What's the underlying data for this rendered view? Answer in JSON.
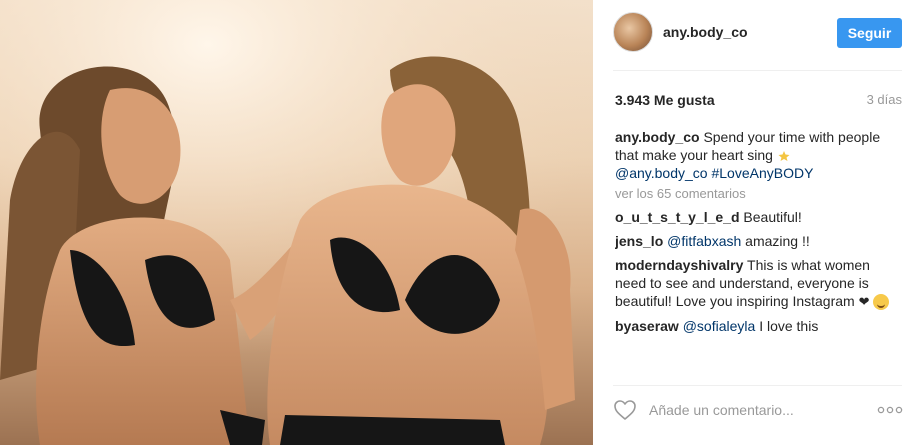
{
  "post": {
    "username": "any.body_co",
    "follow_label": "Seguir",
    "likes": "3.943 Me gusta",
    "time": "3 días",
    "caption_text": "Spend your time with people that make your heart sing",
    "caption_mention": "@any.body_co",
    "caption_hashtag": "#LoveAnyBODY",
    "view_comments": "ver los 65 comentarios"
  },
  "comments": [
    {
      "user": "o_u_t_s_t_y_l_e_d",
      "text": "Beautiful!"
    },
    {
      "user": "jens_lo",
      "mention": "@fitfabxash",
      "text": "amazing !!"
    },
    {
      "user": "moderndayshivalry",
      "text": "This is what women need to see and understand, everyone is beautiful! Love you inspiring Instagram"
    },
    {
      "user": "byaseraw",
      "mention": "@sofialeyla",
      "text": "I love this"
    }
  ],
  "add_comment": {
    "placeholder": "Añade un comentario..."
  },
  "icons": {
    "like": "heart-outline-icon",
    "options": "more-dots-icon",
    "avatar": "profile-avatar"
  },
  "colors": {
    "accent": "#3897f0",
    "link": "#003569",
    "muted": "#999999"
  }
}
